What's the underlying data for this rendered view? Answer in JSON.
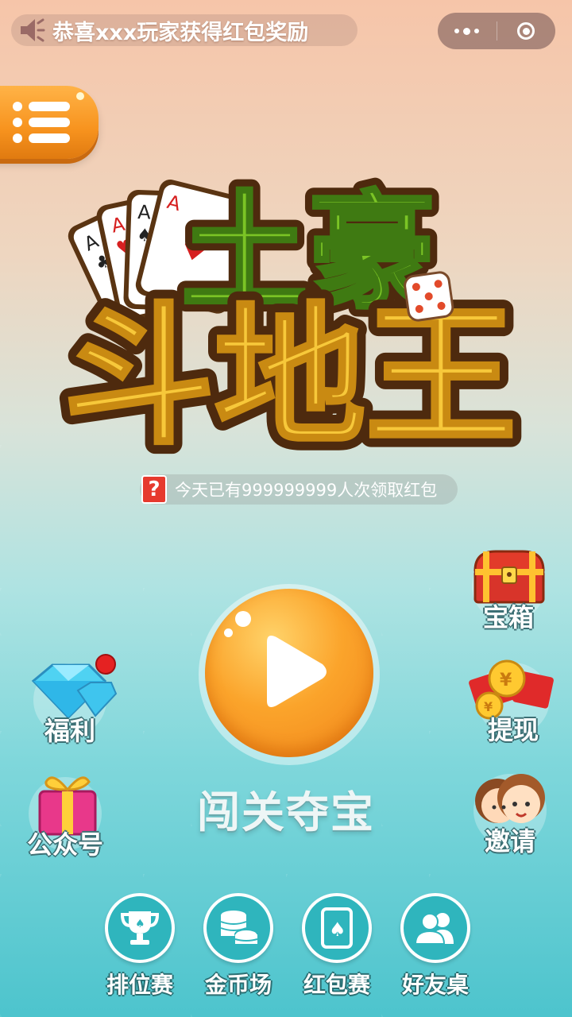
{
  "notice": {
    "icon": "speaker-icon",
    "text": "恭喜xxx玩家获得红包奖励"
  },
  "capsule": {
    "more_icon": "more-dots-icon",
    "close_icon": "target-close-icon"
  },
  "menu": {
    "icon": "menu-list-icon"
  },
  "logo": {
    "line1": "土豪",
    "line2": "斗地王"
  },
  "tagline": {
    "icon_text": "?",
    "text": "今天已有999999999人次领取红包"
  },
  "play": {
    "label": "闯关夺宝",
    "icon": "play-icon"
  },
  "left_items": [
    {
      "label": "福利",
      "icon": "diamond-icon"
    },
    {
      "label": "公众号",
      "icon": "gift-box-icon"
    }
  ],
  "right_items": [
    {
      "label": "宝箱",
      "icon": "treasure-chest-icon"
    },
    {
      "label": "提现",
      "icon": "red-envelope-coin-icon"
    },
    {
      "label": "邀请",
      "icon": "friends-avatar-icon"
    }
  ],
  "bottom_nav": [
    {
      "label": "排位赛",
      "icon": "trophy-icon"
    },
    {
      "label": "金币场",
      "icon": "coin-stack-icon"
    },
    {
      "label": "红包赛",
      "icon": "card-spade-icon"
    },
    {
      "label": "好友桌",
      "icon": "people-icon"
    }
  ],
  "colors": {
    "accent_orange": "#f7931e",
    "teal": "#2fb5bd",
    "red_dot": "#e52222"
  }
}
